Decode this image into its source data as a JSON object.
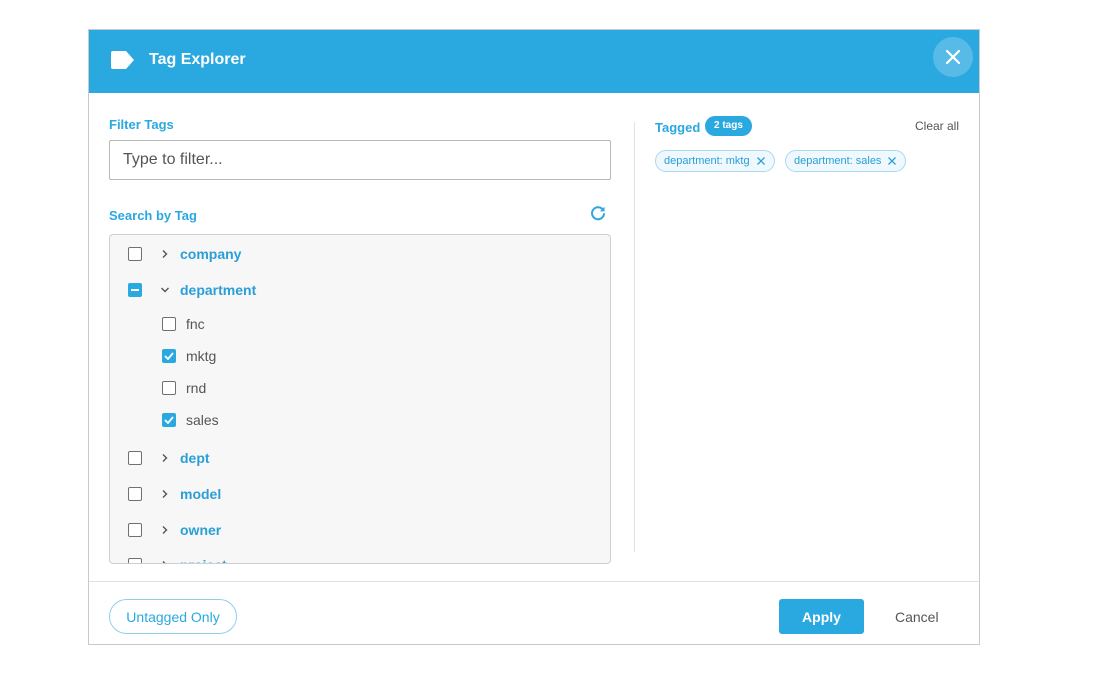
{
  "header": {
    "title": "Tag Explorer",
    "tag_icon": "tag-icon",
    "close_icon": "close-icon",
    "color": "#2aa8e0"
  },
  "filter": {
    "label": "Filter Tags",
    "placeholder": "Type to filter...",
    "value": ""
  },
  "search": {
    "label": "Search by Tag",
    "refresh_icon": "refresh-icon"
  },
  "tree": [
    {
      "label": "company",
      "state": "unchecked",
      "expanded": false,
      "children": []
    },
    {
      "label": "department",
      "state": "partial",
      "expanded": true,
      "children": [
        {
          "label": "fnc",
          "checked": false
        },
        {
          "label": "mktg",
          "checked": true
        },
        {
          "label": "rnd",
          "checked": false
        },
        {
          "label": "sales",
          "checked": true
        }
      ]
    },
    {
      "label": "dept",
      "state": "unchecked",
      "expanded": false,
      "children": []
    },
    {
      "label": "model",
      "state": "unchecked",
      "expanded": false,
      "children": []
    },
    {
      "label": "owner",
      "state": "unchecked",
      "expanded": false,
      "children": []
    },
    {
      "label": "project",
      "state": "unchecked",
      "expanded": false,
      "children": []
    }
  ],
  "tagged": {
    "label": "Tagged",
    "count_badge": "2 tags",
    "clear_all": "Clear all",
    "chips": [
      {
        "text": "department: mktg"
      },
      {
        "text": "department: sales"
      }
    ]
  },
  "footer": {
    "untagged_label": "Untagged Only",
    "apply_label": "Apply",
    "cancel_label": "Cancel"
  }
}
